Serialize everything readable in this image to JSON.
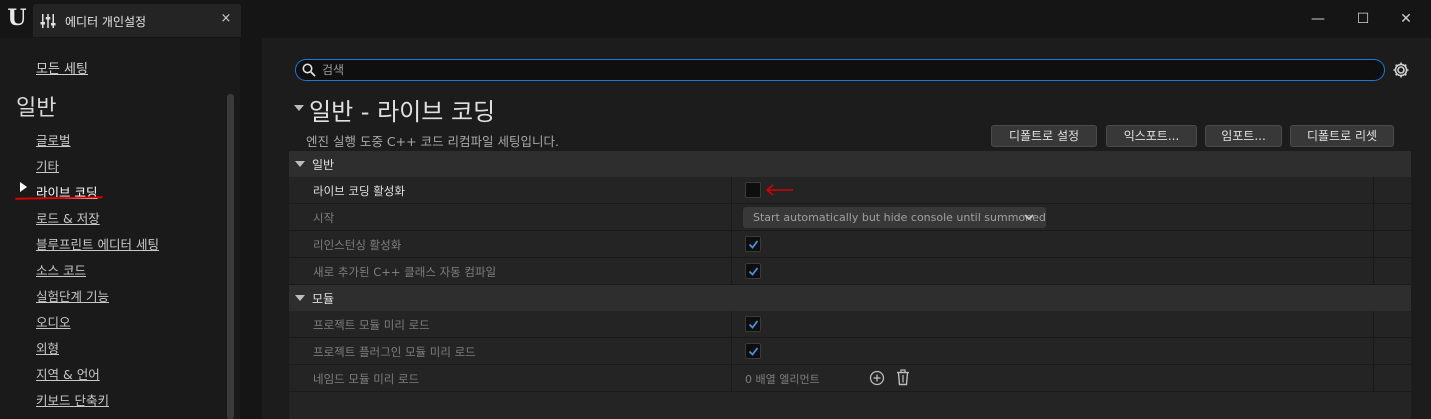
{
  "window": {
    "tab_title": "에디터 개인설정",
    "close_tab": "×",
    "minimize": "—",
    "maximize": "☐",
    "close": "✕"
  },
  "sidebar": {
    "all_settings": "모든 세팅",
    "heading": "일반",
    "items": [
      {
        "label": "글로벌",
        "active": false
      },
      {
        "label": "기타",
        "active": false
      },
      {
        "label": "라이브 코딩",
        "active": true
      },
      {
        "label": "로드 & 저장",
        "active": false
      },
      {
        "label": "블루프린트 에디터 세팅",
        "active": false
      },
      {
        "label": "소스 코드",
        "active": false
      },
      {
        "label": "실험단계 기능",
        "active": false
      },
      {
        "label": "오디오",
        "active": false
      },
      {
        "label": "외형",
        "active": false
      },
      {
        "label": "지역 & 언어",
        "active": false
      },
      {
        "label": "키보드 단축키",
        "active": false
      }
    ]
  },
  "search": {
    "placeholder": "검색",
    "value": ""
  },
  "section": {
    "title": "일반 - 라이브 코딩",
    "description": "엔진 실행 도중 C++ 코드 리컴파일 세팅입니다."
  },
  "buttons": {
    "set_default": "디폴트로 설정",
    "export": "익스포트...",
    "import": "임포트...",
    "reset_default": "디폴트로 리셋"
  },
  "categories": {
    "general": "일반",
    "modules": "모듈"
  },
  "properties": {
    "enable_live_coding": {
      "label": "라이브 코딩 활성화",
      "checked": false
    },
    "startup": {
      "label": "시작",
      "value": "Start automatically but hide console until summoned"
    },
    "enable_reinstancing": {
      "label": "리인스턴싱 활성화",
      "checked": true
    },
    "auto_compile_new_classes": {
      "label": "새로 추가된 C++ 클래스 자동 컴파일",
      "checked": true
    },
    "preload_project_modules": {
      "label": "프로젝트 모듈 미리 로드",
      "checked": true
    },
    "preload_project_plugin_modules": {
      "label": "프로젝트 플러그인 모듈 미리 로드",
      "checked": true
    },
    "preload_named_modules": {
      "label": "네임드 모듈 미리 로드",
      "value": "0 배열 엘리먼트"
    }
  },
  "colors": {
    "accent_blue": "#1a7bd6",
    "annotation_red": "#d40000"
  }
}
